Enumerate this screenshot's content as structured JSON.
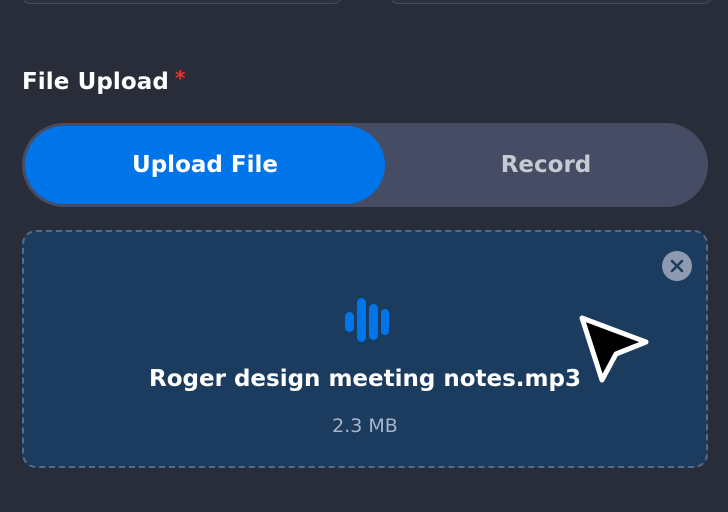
{
  "form": {
    "field_label": "File Upload",
    "required_mark": "*"
  },
  "upload_mode": {
    "options": [
      {
        "label": "Upload File",
        "selected": true
      },
      {
        "label": "Record",
        "selected": false
      }
    ]
  },
  "uploaded_file": {
    "name": "Roger design meeting notes.mp3",
    "size": "2.3 MB",
    "icon": "audio-waveform-icon",
    "remove_icon": "close-icon"
  },
  "colors": {
    "background": "#292d3a",
    "accent": "#0075ea",
    "dropzone_bg": "#1b3b5f",
    "segmented_bg": "#454c64",
    "required": "#e8342c"
  }
}
